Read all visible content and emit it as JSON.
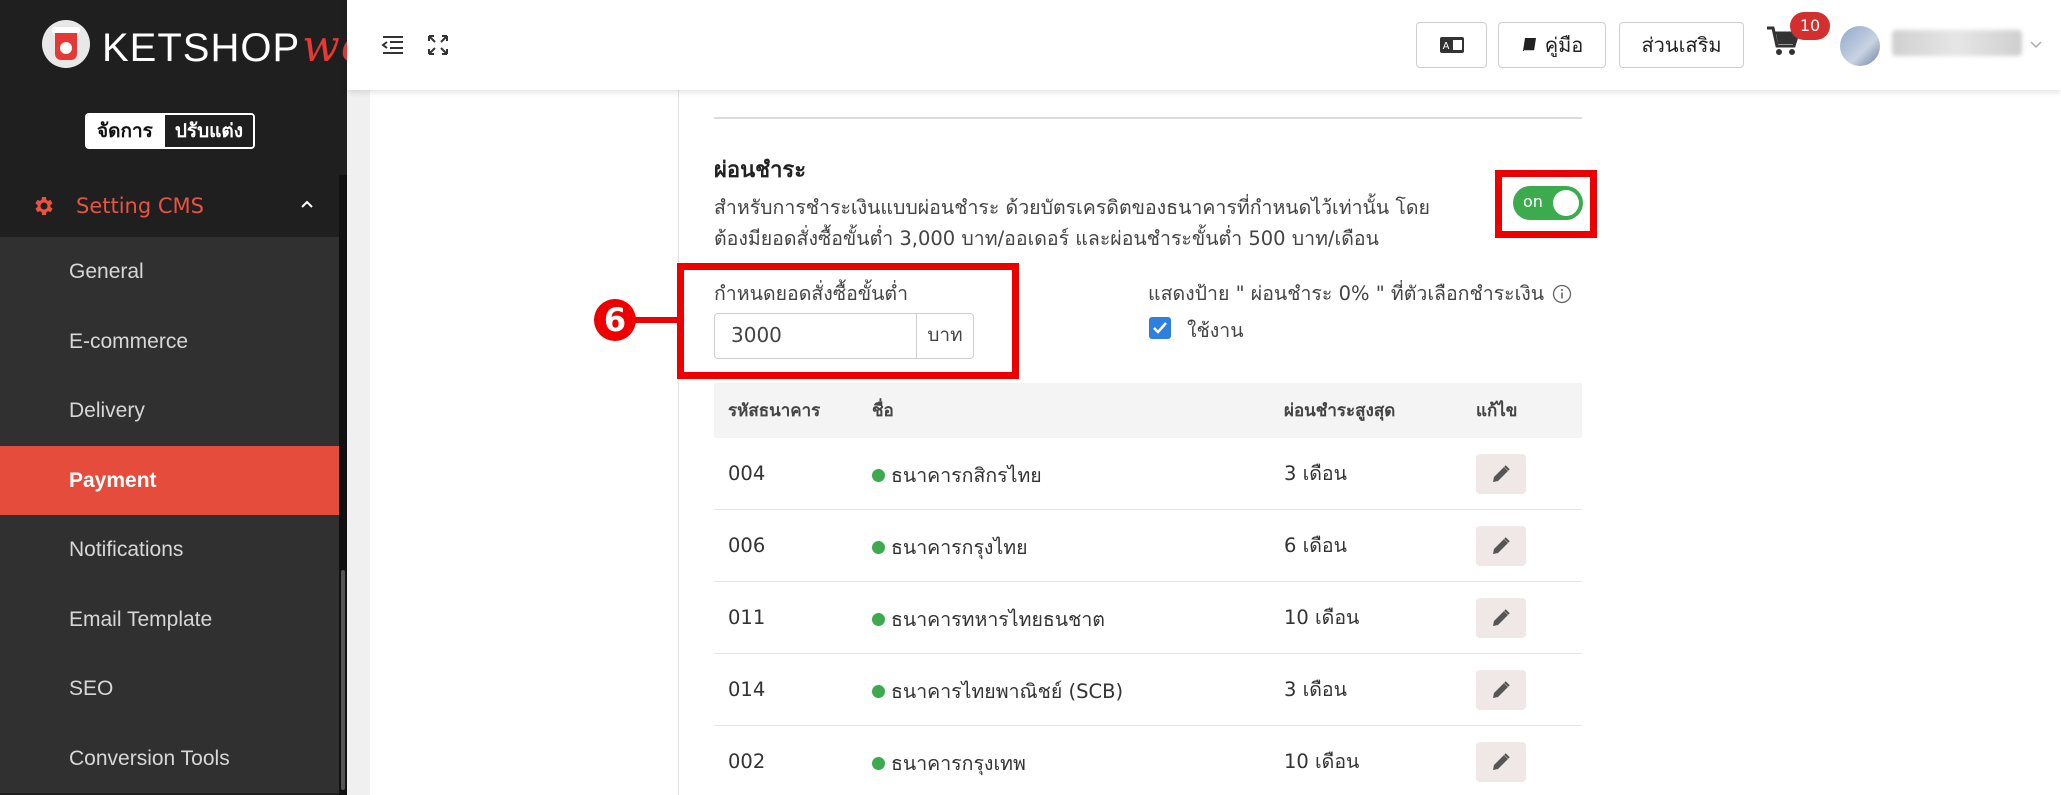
{
  "brand": {
    "name": "KETSHOP",
    "suffix": "web"
  },
  "mode_switch": {
    "manage": "จัดการ",
    "customize": "ปรับแต่ง"
  },
  "menu": {
    "parent": "Setting CMS",
    "items": [
      {
        "label": "General",
        "active": false
      },
      {
        "label": "E-commerce",
        "active": false
      },
      {
        "label": "Delivery",
        "active": false
      },
      {
        "label": "Payment",
        "active": true
      },
      {
        "label": "Notifications",
        "active": false
      },
      {
        "label": "Email Template",
        "active": false
      },
      {
        "label": "SEO",
        "active": false
      },
      {
        "label": "Conversion Tools",
        "active": false
      }
    ]
  },
  "topbar": {
    "manual_label": "คู่มือ",
    "addons_label": "ส่วนเสริม",
    "cart_count": "10"
  },
  "installment": {
    "title": "ผ่อนชำระ",
    "description_line1": "สำหรับการชำระเงินแบบผ่อนชำระ ด้วยบัตรเครดิตของธนาคารที่กำหนดไว้เท่านั้น โดย",
    "description_line2": "ต้องมียอดสั่งซื้อขั้นต่ำ 3,000 บาท/ออเดอร์ และผ่อนชำระขั้นต่ำ 500 บาท/เดือน",
    "toggle_label": "on",
    "enabled": true,
    "min_order_label": "กำหนดยอดสั่งซื้อขั้นต่ำ",
    "min_order_value": "3000",
    "currency_unit": "บาท",
    "badge_label": "แสดงป้าย \" ผ่อนชำระ 0% \" ที่ตัวเลือกชำระเงิน",
    "use_label": "ใช้งาน",
    "use_checked": true,
    "callout_number": "6"
  },
  "bank_table": {
    "headers": [
      "รหัสธนาคาร",
      "ชื่อ",
      "ผ่อนชำระสูงสุด",
      "แก้ไข"
    ],
    "rows": [
      {
        "code": "004",
        "name": "ธนาคารกสิกรไทย",
        "max": "3 เดือน"
      },
      {
        "code": "006",
        "name": "ธนาคารกรุงไทย",
        "max": "6 เดือน"
      },
      {
        "code": "011",
        "name": "ธนาคารทหารไทยธนชาต",
        "max": "10 เดือน"
      },
      {
        "code": "014",
        "name": "ธนาคารไทยพาณิชย์ (SCB)",
        "max": "3 เดือน"
      },
      {
        "code": "002",
        "name": "ธนาคารกรุงเทพ",
        "max": "10 เดือน"
      }
    ]
  },
  "colors": {
    "accent": "#e64c3c",
    "sidebar_bg": "#1f1f1f",
    "toggle_on": "#3bab4e",
    "highlight": "#ee0000",
    "checkbox": "#2f7fe0"
  }
}
